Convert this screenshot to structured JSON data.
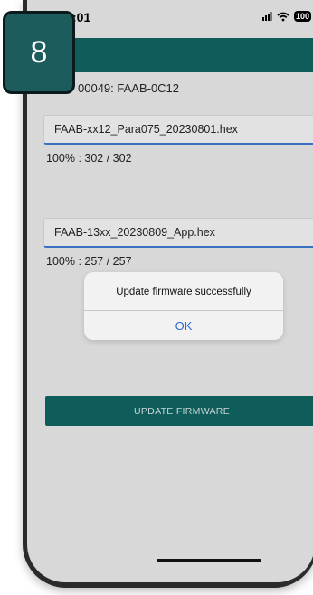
{
  "status_bar": {
    "time": ":01",
    "battery": "100"
  },
  "device_line": "00049: FAAB-0C12",
  "files": [
    {
      "name": "FAAB-xx12_Para075_20230801.hex",
      "progress": "100% : 302 / 302",
      "percent": 100
    },
    {
      "name": "FAAB-13xx_20230809_App.hex",
      "progress": "100% : 257 / 257",
      "percent": 100
    }
  ],
  "update_button": "UPDATE FIRMWARE",
  "dialog": {
    "message": "Update firmware successfully",
    "ok_label": "OK"
  },
  "step_badge": "8",
  "colors": {
    "app_bar": "#0f5d5a",
    "progress": "#3a6fc4",
    "dialog_ok": "#2d68d6",
    "badge": "#1c5c5c"
  }
}
